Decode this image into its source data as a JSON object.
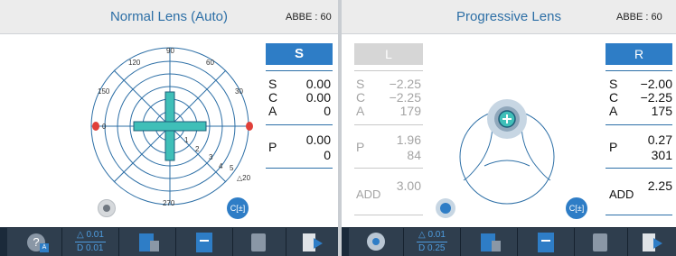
{
  "left_panel": {
    "title": "Normal Lens (Auto)",
    "abbe": "ABBE : 60",
    "side_button": "S",
    "protractor_labels": [
      "90",
      "60",
      "30",
      "0",
      "150",
      "120",
      "270"
    ],
    "scale_labels": [
      "1",
      "2",
      "3",
      "4",
      "5",
      "△20"
    ],
    "measurements": [
      {
        "label": "S",
        "value": "0.00"
      },
      {
        "label": "C",
        "value": "0.00"
      },
      {
        "label": "A",
        "value": "0"
      }
    ],
    "prism": {
      "label": "P",
      "value1": "0.00",
      "value2": "0"
    },
    "cyl_mode_button": "C[±]",
    "toolbar": {
      "delta_label": "△ 0.01",
      "d_label": "D 0.01"
    }
  },
  "right_panel": {
    "title": "Progressive Lens",
    "abbe": "ABBE : 60",
    "left_lens": {
      "button": "L",
      "measurements": [
        {
          "label": "S",
          "value": "−2.25"
        },
        {
          "label": "C",
          "value": "−2.25"
        },
        {
          "label": "A",
          "value": "179"
        }
      ],
      "prism": {
        "label": "P",
        "value1": "1.96",
        "value2": "84"
      },
      "add": {
        "label": "ADD",
        "value": "3.00"
      }
    },
    "right_lens": {
      "button": "R",
      "measurements": [
        {
          "label": "S",
          "value": "−2.00"
        },
        {
          "label": "C",
          "value": "−2.25"
        },
        {
          "label": "A",
          "value": "175"
        }
      ],
      "prism": {
        "label": "P",
        "value1": "0.27",
        "value2": "301"
      },
      "add": {
        "label": "ADD",
        "value": "2.25"
      }
    },
    "cyl_mode_button": "C[±]",
    "toolbar": {
      "delta_label": "△ 0.01",
      "d_label": "D 0.25"
    }
  }
}
